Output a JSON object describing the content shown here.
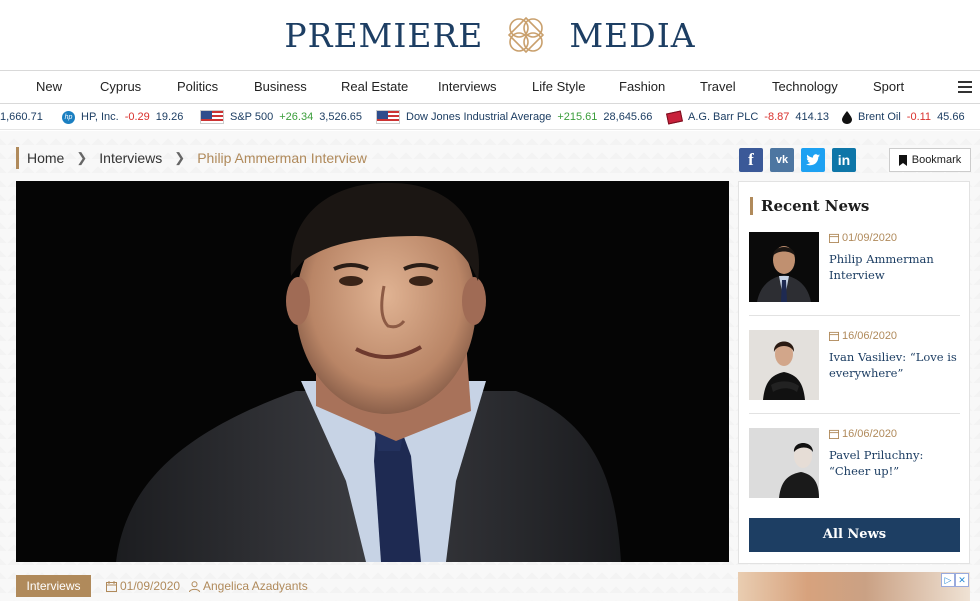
{
  "logo": {
    "left": "PREMIERE",
    "right": "MEDIA"
  },
  "nav": [
    "New",
    "Cyprus",
    "Politics",
    "Business",
    "Real Estate",
    "Interviews",
    "Life Style",
    "Fashion",
    "Travel",
    "Technology",
    "Sport"
  ],
  "ticker": {
    "partial_value": "1,660.71",
    "items": [
      {
        "name": "HP, Inc.",
        "change": "-0.29",
        "value": "19.26",
        "direction": "down",
        "icon": "hp-logo-icon"
      },
      {
        "name": "S&P 500",
        "change": "+26.34",
        "value": "3,526.65",
        "direction": "up",
        "icon": "us-flag-icon"
      },
      {
        "name": "Dow Jones Industrial Average",
        "change": "+215.61",
        "value": "28,645.66",
        "direction": "up",
        "icon": "us-flag-icon"
      },
      {
        "name": "A.G. Barr PLC",
        "change": "-8.87",
        "value": "414.13",
        "direction": "down",
        "icon": "agbarr-logo-icon"
      },
      {
        "name": "Brent Oil",
        "change": "-0.11",
        "value": "45.66",
        "direction": "down",
        "icon": "oil-drop-icon"
      }
    ]
  },
  "breadcrumb": {
    "home": "Home",
    "section": "Interviews",
    "current": "Philip Ammerman Interview"
  },
  "social": {
    "facebook": "f",
    "vk": "vk",
    "twitter": "t",
    "linkedin": "in"
  },
  "bookmark_label": "Bookmark",
  "article": {
    "category": "Interviews",
    "date": "01/09/2020",
    "author": "Angelica Azadyants"
  },
  "sidebar": {
    "title": "Recent News",
    "items": [
      {
        "date": "01/09/2020",
        "title": "Philip Ammerman Interview"
      },
      {
        "date": "16/06/2020",
        "title": "Ivan Vasiliev: “Love is everywhere”"
      },
      {
        "date": "16/06/2020",
        "title": "Pavel Priluchny: “Cheer up!”"
      }
    ],
    "all_news": "All News"
  },
  "colors": {
    "brand_navy": "#1d3e63",
    "accent_gold": "#b08a5b",
    "up": "#3a9d3a",
    "down": "#d9302c"
  }
}
